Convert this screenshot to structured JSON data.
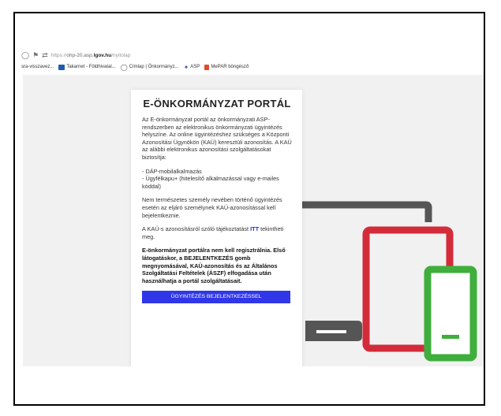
{
  "browser": {
    "url_scheme": "https://",
    "url_host_pre": "ohp-20.asp.",
    "url_host_bold": "lgov.hu",
    "url_path": "/nyitolap"
  },
  "bookmarks": [
    {
      "label": "sra-visszavez...",
      "icon": "none",
      "color": ""
    },
    {
      "label": "Takarnet - Földhivatal...",
      "icon": "takarnet-icon",
      "color": "#1f5bb5"
    },
    {
      "label": "Címlap | Önkormányz...",
      "icon": "globe-icon",
      "color": "#555555"
    },
    {
      "label": "ASP",
      "icon": "asp-icon",
      "color": "#3a5ea8"
    },
    {
      "label": "MePAR böngésző",
      "icon": "mepar-icon",
      "color": "#e04b2a"
    }
  ],
  "panel": {
    "title": "E-ÖNKORMÁNYZAT PORTÁL",
    "intro": "Az E-önkormányzat portál az önkormányzati ASP-rendszerben az elektronikus önkormányzati ügyintézés helyszíne. Az online ügyintézéshez szükséges a Központi Azonosítási Ügynökön (KAÜ) keresztüli azonosítás. A KAÜ az alábbi elektronikus azonosítási szolgáltatásokat biztosítja:",
    "list_item_1": "- DÁP-mobilalkalmazás",
    "list_item_2": "- Ügyfélkapu+ (hitelesítő alkalmazással vagy e-mailes kóddal)",
    "non_natural": "Nem természetes személy nevében történő ügyintézés esetén az eljáró személynek KAÜ-azonosítással kell bejelentkeznie.",
    "info_prefix": "A KAÜ-s azonosításról szóló tájékoztatást ",
    "info_link": "ITT",
    "info_suffix": " tekintheti meg.",
    "bold_text": "E-önkormányzat portálra nem kell regisztrálnia. Első látogatáskor, a BEJELENTKEZÉS gomb megnyomásával, KAÜ-azonosítás és az Általános Szolgáltatási Feltételek (ÁSZF) elfogadása után használhatja a portál szolgáltatásait.",
    "cta_label": "ÜGYINTÉZÉS BEJELENTKEZÉSSEL"
  },
  "colors": {
    "tablet": "#d32b3a",
    "phone": "#3fae3c",
    "monitor": "#555555",
    "button": "#3037e8"
  }
}
